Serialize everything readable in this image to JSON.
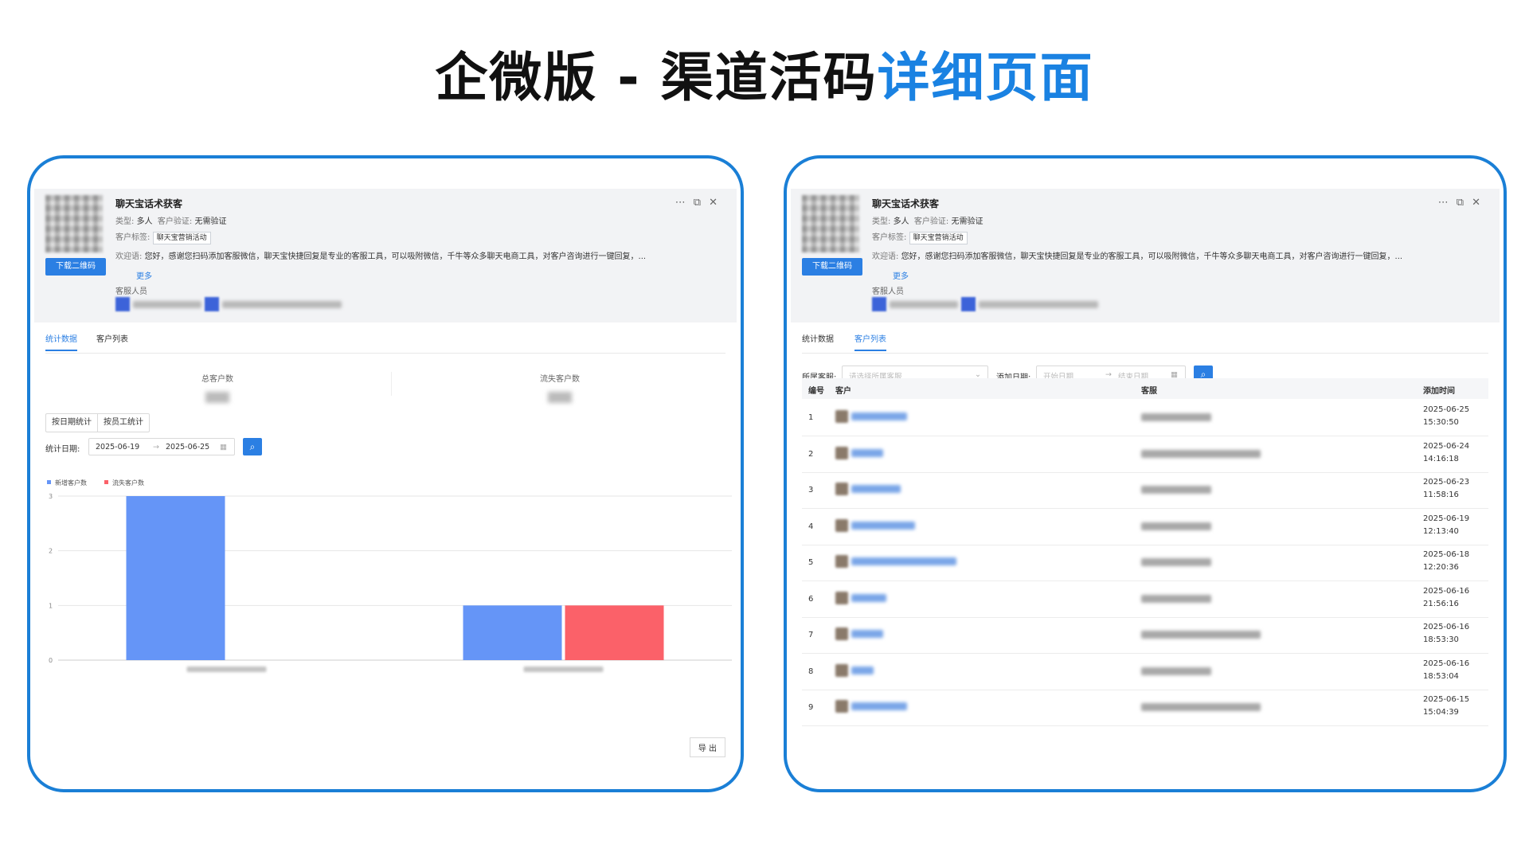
{
  "title": {
    "part1": "企微版 - 渠道活码",
    "part2": "详细页面"
  },
  "colors": {
    "accent": "#2b7fe3",
    "frame": "#1a7fd6",
    "bar_new": "#6595f7",
    "bar_lost": "#fb6169"
  },
  "detail": {
    "name": "聊天宝话术获客",
    "type_label": "类型:",
    "type_value": "多人",
    "verify_label": "客户验证:",
    "verify_value": "无需验证",
    "tag_label": "客户标签:",
    "tag_value": "聊天宝营销活动",
    "welcome_label": "欢迎语:",
    "welcome_text": "您好，感谢您扫码添加客服微信，聊天宝快捷回复是专业的客服工具，可以吸附微信，千牛等众多聊天电商工具，对客户咨询进行一键回复，...",
    "more": "更多",
    "staff_label": "客服人员",
    "download_btn": "下载二维码",
    "icons": [
      "more-icon",
      "popout-icon",
      "close-icon"
    ]
  },
  "left": {
    "tabs": [
      "统计数据",
      "客户列表"
    ],
    "active_tab": 0,
    "stats": {
      "total_label": "总客户数",
      "lost_label": "流失客户数"
    },
    "segments": [
      "按日期统计",
      "按员工统计"
    ],
    "date_label": "统计日期:",
    "date_start": "2025-06-19",
    "date_end": "2025-06-25",
    "export": "导 出"
  },
  "chart_data": {
    "type": "bar",
    "series": [
      {
        "name": "新增客户数",
        "values": [
          3,
          1
        ]
      },
      {
        "name": "流失客户数",
        "values": [
          0,
          1
        ]
      }
    ],
    "categories": [
      "",
      ""
    ],
    "ylim": [
      0,
      3
    ],
    "yticks": [
      "0",
      "1",
      "2",
      "3"
    ],
    "legend": "top-left",
    "grid": true
  },
  "right": {
    "tabs": [
      "统计数据",
      "客户列表"
    ],
    "active_tab": 1,
    "filter_staff_label": "所属客服:",
    "filter_staff_placeholder": "请选择所属客服",
    "filter_date_label": "添加日期:",
    "date_start_placeholder": "开始日期",
    "date_end_placeholder": "结束日期",
    "columns": [
      "编号",
      "客户",
      "客服",
      "添加时间"
    ],
    "rows": [
      {
        "no": "1",
        "date": "2025-06-25",
        "time": "15:30:50"
      },
      {
        "no": "2",
        "date": "2025-06-24",
        "time": "14:16:18"
      },
      {
        "no": "3",
        "date": "2025-06-23",
        "time": "11:58:16"
      },
      {
        "no": "4",
        "date": "2025-06-19",
        "time": "12:13:40"
      },
      {
        "no": "5",
        "date": "2025-06-18",
        "time": "12:20:36"
      },
      {
        "no": "6",
        "date": "2025-06-16",
        "time": "21:56:16"
      },
      {
        "no": "7",
        "date": "2025-06-16",
        "time": "18:53:30"
      },
      {
        "no": "8",
        "date": "2025-06-16",
        "time": "18:53:04"
      },
      {
        "no": "9",
        "date": "2025-06-15",
        "time": "15:04:39"
      }
    ]
  }
}
